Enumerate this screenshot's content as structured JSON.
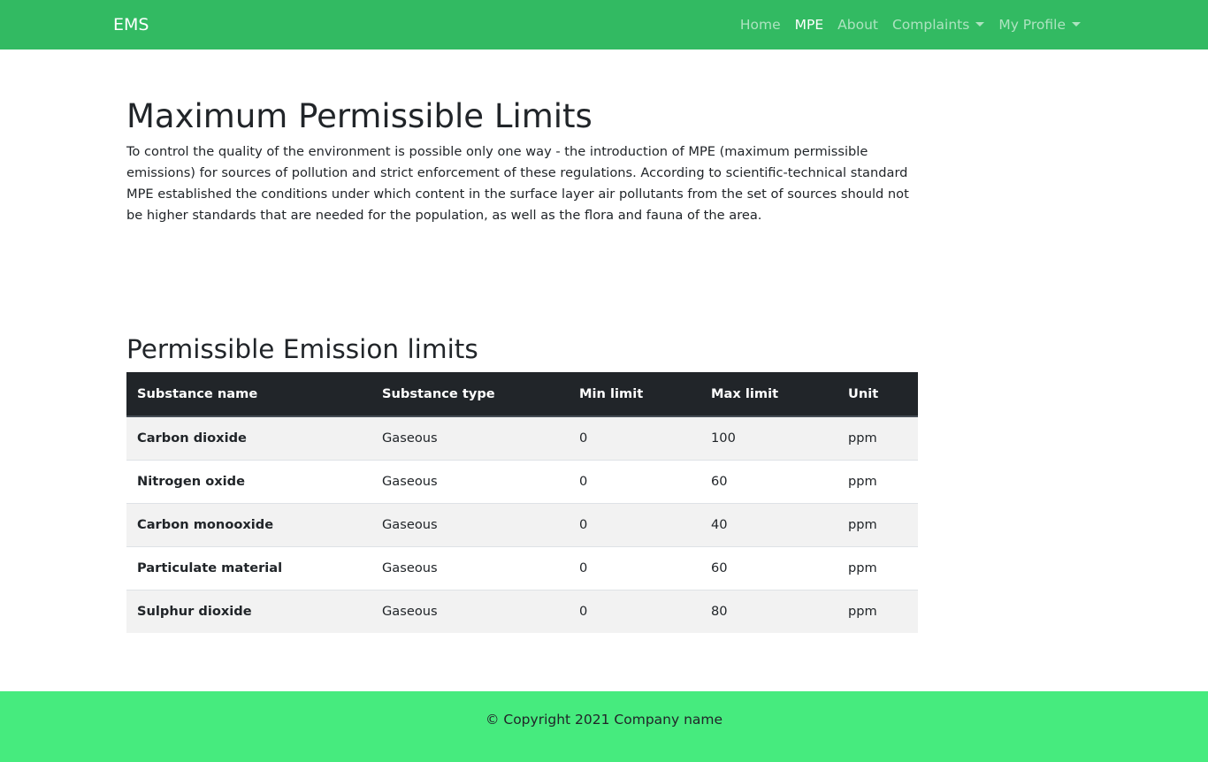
{
  "navbar": {
    "brand": "EMS",
    "links": [
      {
        "label": "Home"
      },
      {
        "label": "MPE"
      },
      {
        "label": "About"
      },
      {
        "label": "Complaints"
      },
      {
        "label": "My Profile"
      }
    ],
    "active": "MPE"
  },
  "main": {
    "title": "Maximum Permissible Limits",
    "intro": "To control the quality of the environment is possible only one way - the introduction of MPE (maximum permissible emissions) for sources of pollution and strict enforcement of these regulations. According to scientific-technical standard MPE established the conditions under which content in the surface layer air pollutants from the set of sources should not be higher standards that are needed for the population, as well as the flora and fauna of the area."
  },
  "limits": {
    "title": "Permissible Emission limits",
    "headers": [
      "Substance name",
      "Substance type",
      "Min limit",
      "Max limit",
      "Unit"
    ],
    "rows": [
      [
        "Carbon dioxide",
        "Gaseous",
        "0",
        "100",
        "ppm"
      ],
      [
        "Nitrogen oxide",
        "Gaseous",
        "0",
        "60",
        "ppm"
      ],
      [
        "Carbon monooxide",
        "Gaseous",
        "0",
        "40",
        "ppm"
      ],
      [
        "Particulate material",
        "Gaseous",
        "0",
        "60",
        "ppm"
      ],
      [
        "Sulphur dioxide",
        "Gaseous",
        "0",
        "80",
        "ppm"
      ]
    ]
  },
  "footer": {
    "copyright": "© Copyright 2021 Company name"
  },
  "colors": {
    "navbar": "#32ba62",
    "footer": "#46eb7e",
    "table_header": "#212529"
  }
}
